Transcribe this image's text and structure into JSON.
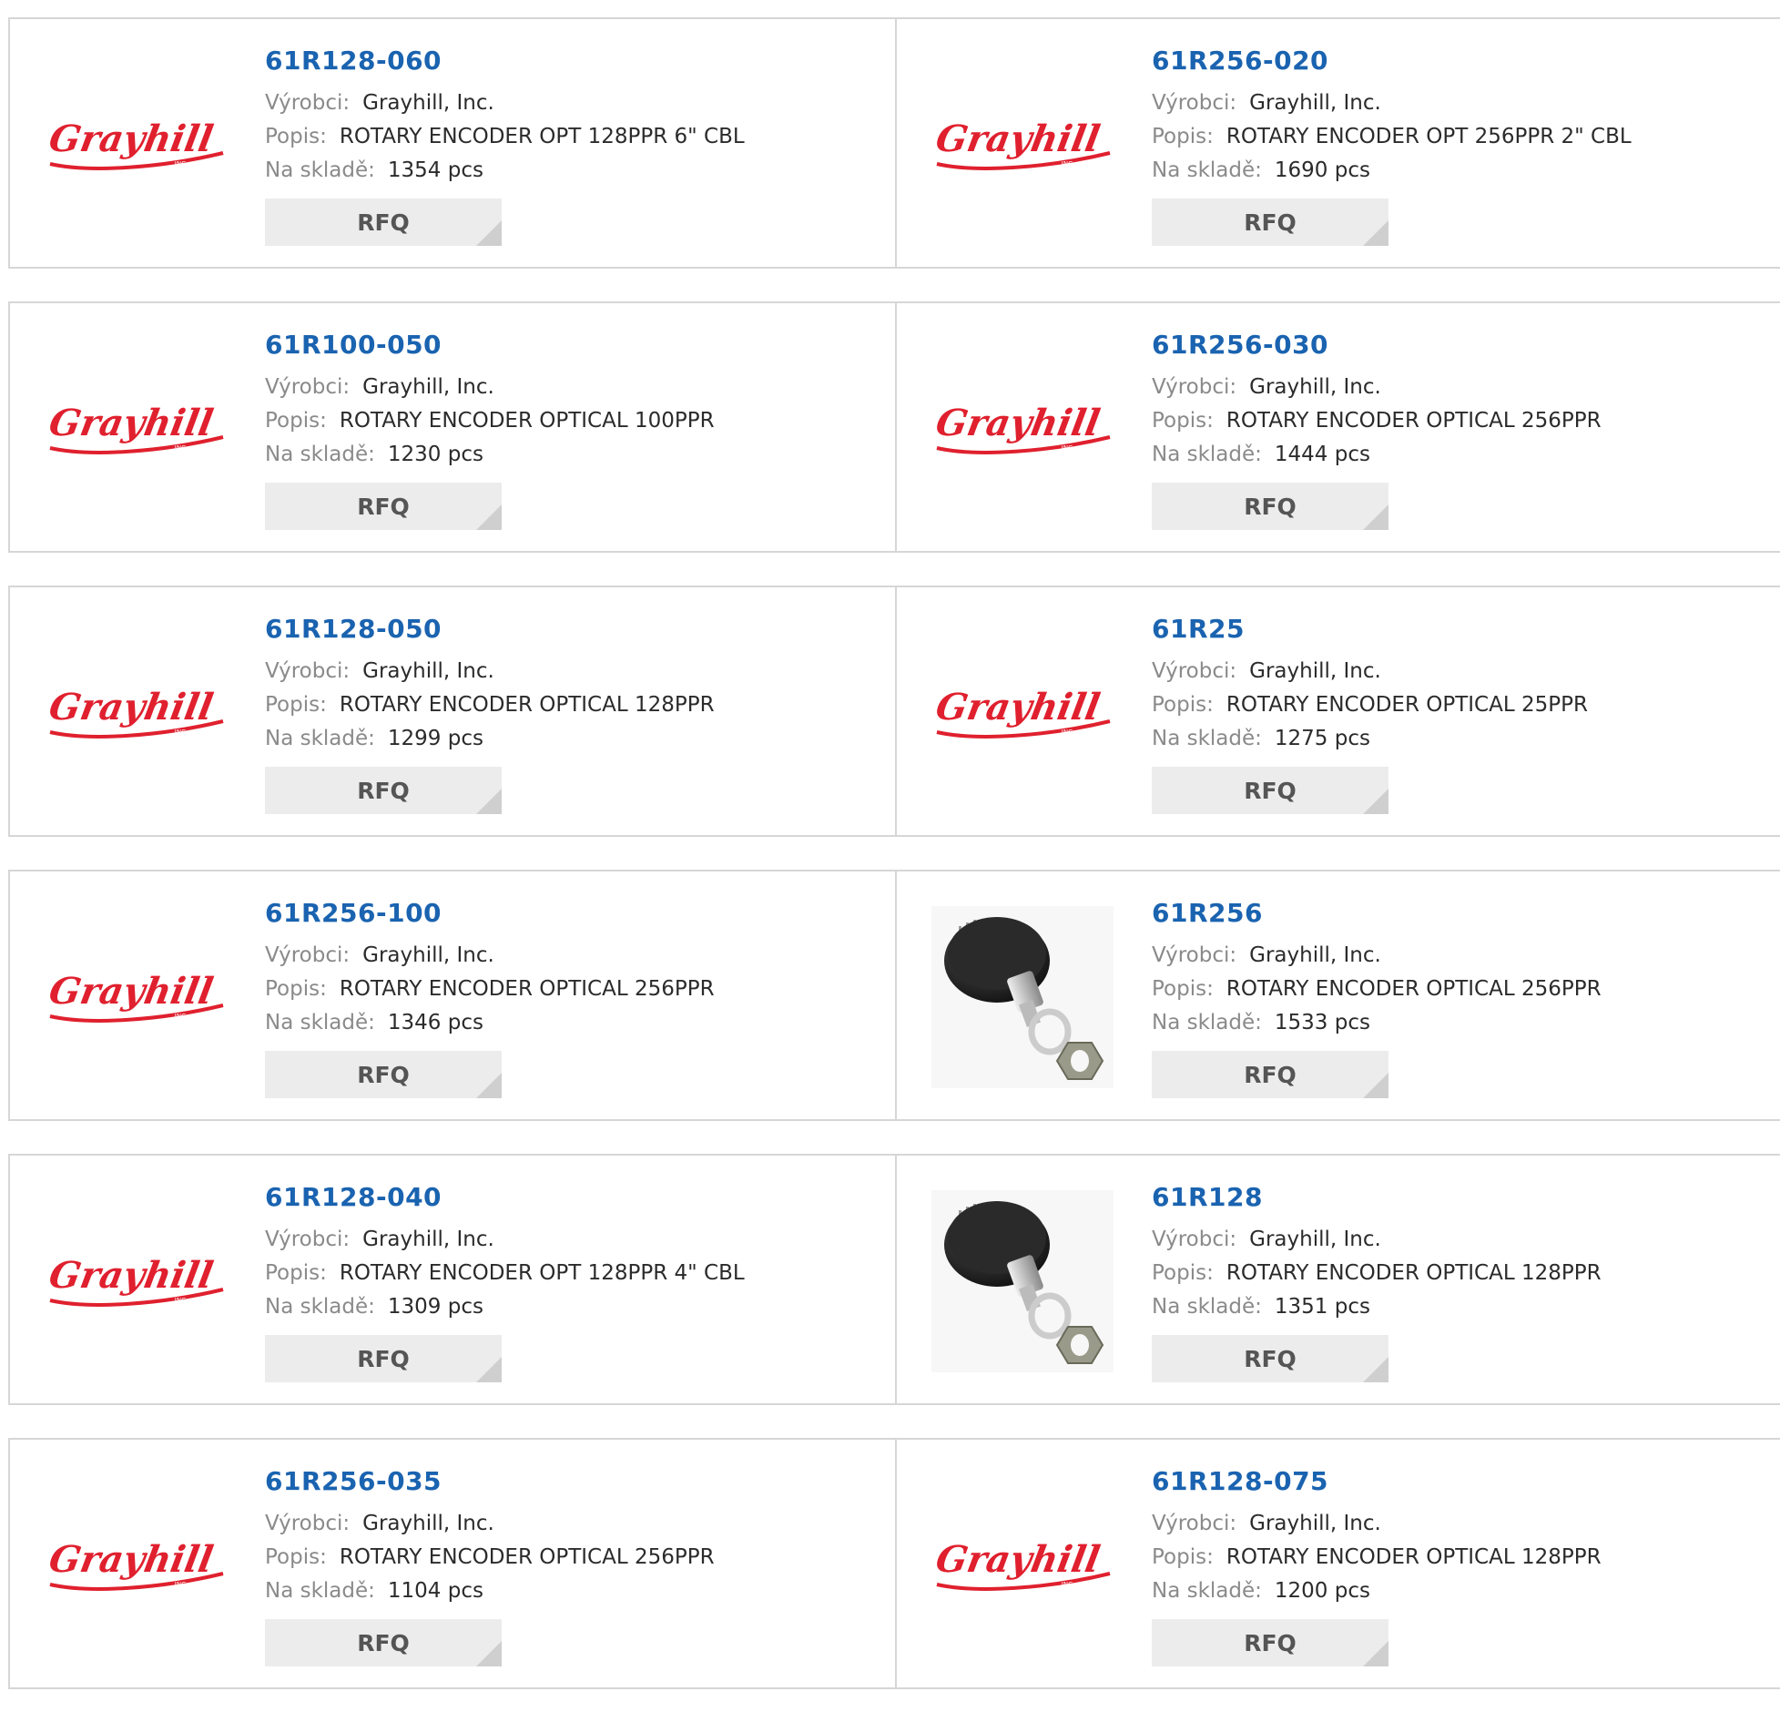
{
  "labels": {
    "manufacturer": "Výrobci:",
    "description": "Popis:",
    "stock": "Na skladě:"
  },
  "logo_text": "Grayhill",
  "logo_sub": "INC.",
  "colors": {
    "part_number": "#1a63b0",
    "logo": "#e0202e",
    "label": "#8a8a8a",
    "value": "#2b2b2b",
    "rfq_bg": "#ececec",
    "border": "#d6d6d6"
  },
  "products": [
    {
      "part": "61R128-060",
      "manufacturer": "Grayhill, Inc.",
      "description": "ROTARY ENCODER OPT 128PPR 6\" CBL",
      "stock": "1354 pcs",
      "image": "logo",
      "rfq": "RFQ"
    },
    {
      "part": "61R256-020",
      "manufacturer": "Grayhill, Inc.",
      "description": "ROTARY ENCODER OPT 256PPR 2\" CBL",
      "stock": "1690 pcs",
      "image": "logo",
      "rfq": "RFQ"
    },
    {
      "part": "61R100-050",
      "manufacturer": "Grayhill, Inc.",
      "description": "ROTARY ENCODER OPTICAL 100PPR",
      "stock": "1230 pcs",
      "image": "logo",
      "rfq": "RFQ"
    },
    {
      "part": "61R256-030",
      "manufacturer": "Grayhill, Inc.",
      "description": "ROTARY ENCODER OPTICAL 256PPR",
      "stock": "1444 pcs",
      "image": "logo",
      "rfq": "RFQ"
    },
    {
      "part": "61R128-050",
      "manufacturer": "Grayhill, Inc.",
      "description": "ROTARY ENCODER OPTICAL 128PPR",
      "stock": "1299 pcs",
      "image": "logo",
      "rfq": "RFQ"
    },
    {
      "part": "61R25",
      "manufacturer": "Grayhill, Inc.",
      "description": "ROTARY ENCODER OPTICAL 25PPR",
      "stock": "1275 pcs",
      "image": "logo",
      "rfq": "RFQ"
    },
    {
      "part": "61R256-100",
      "manufacturer": "Grayhill, Inc.",
      "description": "ROTARY ENCODER OPTICAL 256PPR",
      "stock": "1346 pcs",
      "image": "logo",
      "rfq": "RFQ"
    },
    {
      "part": "61R256",
      "manufacturer": "Grayhill, Inc.",
      "description": "ROTARY ENCODER OPTICAL 256PPR",
      "stock": "1533 pcs",
      "image": "encoder-photo",
      "rfq": "RFQ"
    },
    {
      "part": "61R128-040",
      "manufacturer": "Grayhill, Inc.",
      "description": "ROTARY ENCODER OPT 128PPR 4\" CBL",
      "stock": "1309 pcs",
      "image": "logo",
      "rfq": "RFQ"
    },
    {
      "part": "61R128",
      "manufacturer": "Grayhill, Inc.",
      "description": "ROTARY ENCODER OPTICAL 128PPR",
      "stock": "1351 pcs",
      "image": "encoder-photo",
      "rfq": "RFQ"
    },
    {
      "part": "61R256-035",
      "manufacturer": "Grayhill, Inc.",
      "description": "ROTARY ENCODER OPTICAL 256PPR",
      "stock": "1104 pcs",
      "image": "logo",
      "rfq": "RFQ"
    },
    {
      "part": "61R128-075",
      "manufacturer": "Grayhill, Inc.",
      "description": "ROTARY ENCODER OPTICAL 128PPR",
      "stock": "1200 pcs",
      "image": "logo",
      "rfq": "RFQ"
    }
  ]
}
